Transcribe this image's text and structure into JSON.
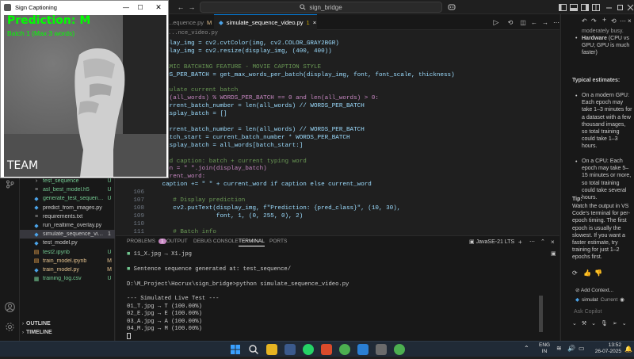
{
  "titlebar": {
    "search_text": "sign_bridge",
    "back_label": "←",
    "forward_label": "→"
  },
  "overlay": {
    "title": "Sign Captioning",
    "prediction": "Prediction: M",
    "batch_info": "Batch 1 (Max 3 words)",
    "caption": "TEAM",
    "colors": {
      "prediction": "#00ff00",
      "caption": "#ffffff"
    }
  },
  "editor": {
    "tabs": [
      {
        "label": "...equence.py",
        "badge": "M",
        "active": false
      },
      {
        "label": "simulate_sequence_video.py",
        "badge": "1",
        "active": true
      }
    ],
    "breadcrumb": "...nce_video.py",
    "code_lines": [
      {
        "n": "",
        "t": "isplay_img = cv2.cvtColor(img, cv2.COLOR_GRAY2BGR)"
      },
      {
        "n": "",
        "t": "isplay_img = cv2.resize(display_img, (400, 400))"
      },
      {
        "n": "",
        "t": ""
      },
      {
        "n": "",
        "t": "YNAMIC BATCHING FEATURE - MOVIE CAPTION STYLE"
      },
      {
        "n": "",
        "t": "ORDS_PER_BATCH = get_max_words_per_batch(display_img, font, font_scale, thickness)"
      },
      {
        "n": "",
        "t": ""
      },
      {
        "n": "",
        "t": "alculate current batch"
      },
      {
        "n": "",
        "t": "len(all_words) % WORDS_PER_BATCH == 0 and len(all_words) > 0:"
      },
      {
        "n": "",
        "t": " current_batch_number = len(all_words) // WORDS_PER_BATCH"
      },
      {
        "n": "",
        "t": " display_batch = []"
      },
      {
        "n": "",
        "t": "e:"
      },
      {
        "n": "",
        "t": " current_batch_number = len(all_words) // WORDS_PER_BATCH"
      },
      {
        "n": "",
        "t": " batch_start = current_batch_number * WORDS_PER_BATCH"
      },
      {
        "n": "",
        "t": " display_batch = all_words[batch_start:]"
      },
      {
        "n": "",
        "t": ""
      },
      {
        "n": "",
        "t": "uild caption: batch + current typing word"
      },
      {
        "n": "",
        "t": "tion = \" \".join(display_batch)"
      },
      {
        "n": "",
        "t": "current_word:"
      },
      {
        "n": "",
        "t": " caption += \" \" + current_word if caption else current_word"
      },
      {
        "n": "106",
        "t": ""
      },
      {
        "n": "107",
        "t": "    # Display prediction"
      },
      {
        "n": "108",
        "t": "    cv2.putText(display_img, f\"Prediction: {pred_class}\", (10, 30),"
      },
      {
        "n": "109",
        "t": "                font, 1, (0, 255, 0), 2)"
      },
      {
        "n": "110",
        "t": ""
      },
      {
        "n": "111",
        "t": "    # Batch info"
      }
    ]
  },
  "explorer": {
    "items": [
      {
        "name": "test_sequence",
        "status": "U",
        "color": "#73c991",
        "icon": "folder-icon"
      },
      {
        "name": "asl_best_model.h5",
        "status": "U",
        "color": "#73c991",
        "icon": "model-file-icon"
      },
      {
        "name": "generate_test_sequence...",
        "status": "U",
        "color": "#73c991",
        "icon": "python-icon"
      },
      {
        "name": "predict_from_images.py",
        "status": "",
        "color": "#cccccc",
        "icon": "python-icon"
      },
      {
        "name": "requirements.txt",
        "status": "",
        "color": "#cccccc",
        "icon": "text-file-icon"
      },
      {
        "name": "run_realtime_overlay.py",
        "status": "",
        "color": "#cccccc",
        "icon": "python-icon"
      },
      {
        "name": "simulate_sequence_video...",
        "status": "1",
        "color": "#cccccc",
        "icon": "python-icon"
      },
      {
        "name": "test_model.py",
        "status": "",
        "color": "#cccccc",
        "icon": "python-icon"
      },
      {
        "name": "test2.ipynb",
        "status": "U",
        "color": "#73c991",
        "icon": "notebook-icon"
      },
      {
        "name": "train_model.ipynb",
        "status": "M",
        "color": "#e2c08d",
        "icon": "notebook-icon"
      },
      {
        "name": "train_model.py",
        "status": "M",
        "color": "#e2c08d",
        "icon": "python-icon"
      },
      {
        "name": "training_log.csv",
        "status": "U",
        "color": "#73c991",
        "icon": "csv-icon"
      }
    ],
    "outline_label": "OUTLINE",
    "timeline_label": "TIMELINE"
  },
  "panel": {
    "tabs": [
      "PROBLEMS",
      "OUTPUT",
      "DEBUG CONSOLE",
      "TERMINAL",
      "PORTS"
    ],
    "problems_count": "1",
    "active_tab": "TERMINAL",
    "shell_label": "JavaSE-21 LTS",
    "terminal_lines": [
      "11_X.jpg → X1.jpg",
      "",
      "Sentence sequence generated at: test_sequence/",
      "",
      "D:\\M_Project\\Hocrux\\sign_bridge>python simulate_sequence_video.py",
      "",
      "--- Simulated Live Test ---",
      "01_T.jpg → T (100.00%)",
      "02_E.jpg → E (100.00%)",
      "03_A.jpg → A (100.00%)",
      "04_M.jpg → M (100.00%)"
    ]
  },
  "chat": {
    "intro": "moderately busy.",
    "hardware_bold": "Hardware",
    "hardware_text": " (CPU vs GPU; GPU is much faster)",
    "estimates_heading": "Typical estimates:",
    "estimates": [
      "On a modern GPU: Each epoch may take 1–3 minutes for a dataset with a few thousand images, so total training could take 1–3 hours.",
      "On a CPU: Each epoch may take 5–15 minutes or more, so total training could take several hours."
    ],
    "tip_heading": "Tip:",
    "tip_text": "Watch the output in VS Code's terminal for per-epoch timing. The first epoch is usually the slowest. If you want a faster estimate, try training for just 1–2 epochs first.",
    "add_context": "Add Context...",
    "file_chip": "simulat",
    "file_chip_tag": "Current",
    "ask_placeholder": "Ask Copilot"
  },
  "taskbar": {
    "lang": "ENG",
    "region": "IN",
    "time": "13:52",
    "date": "26-07-2025"
  }
}
